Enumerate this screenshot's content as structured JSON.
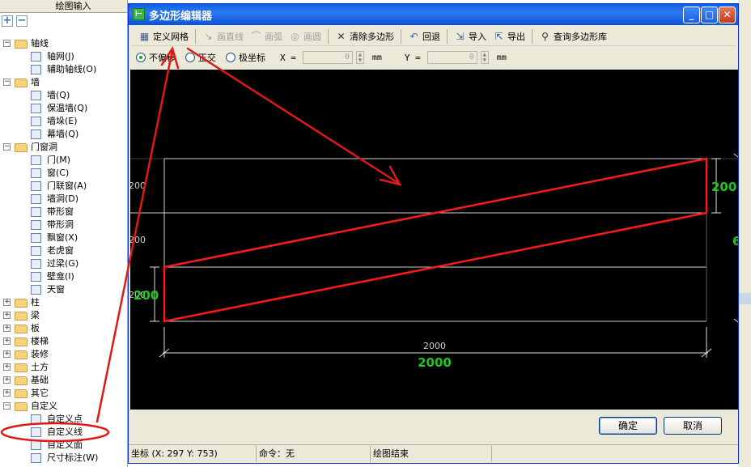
{
  "left_panel": {
    "header": "绘图输入",
    "tree": [
      {
        "type": "cat",
        "label": "轴线",
        "open": true
      },
      {
        "type": "leaf",
        "label": "轴网(J)"
      },
      {
        "type": "leaf",
        "label": "辅助轴线(O)"
      },
      {
        "type": "cat",
        "label": "墙",
        "open": true
      },
      {
        "type": "leaf",
        "label": "墙(Q)"
      },
      {
        "type": "leaf",
        "label": "保温墙(Q)"
      },
      {
        "type": "leaf",
        "label": "墙垛(E)"
      },
      {
        "type": "leaf",
        "label": "幕墙(Q)"
      },
      {
        "type": "cat",
        "label": "门窗洞",
        "open": true
      },
      {
        "type": "leaf",
        "label": "门(M)"
      },
      {
        "type": "leaf",
        "label": "窗(C)"
      },
      {
        "type": "leaf",
        "label": "门联窗(A)"
      },
      {
        "type": "leaf",
        "label": "墙洞(D)"
      },
      {
        "type": "leaf",
        "label": "带形窗"
      },
      {
        "type": "leaf",
        "label": "带形洞"
      },
      {
        "type": "leaf",
        "label": "飘窗(X)"
      },
      {
        "type": "leaf",
        "label": "老虎窗"
      },
      {
        "type": "leaf",
        "label": "过梁(G)"
      },
      {
        "type": "leaf",
        "label": "壁龛(I)"
      },
      {
        "type": "leaf",
        "label": "天窗"
      },
      {
        "type": "cat",
        "label": "柱",
        "open": false
      },
      {
        "type": "cat",
        "label": "梁",
        "open": false
      },
      {
        "type": "cat",
        "label": "板",
        "open": false
      },
      {
        "type": "cat",
        "label": "楼梯",
        "open": false
      },
      {
        "type": "cat",
        "label": "装修",
        "open": false
      },
      {
        "type": "cat",
        "label": "土方",
        "open": false
      },
      {
        "type": "cat",
        "label": "基础",
        "open": false
      },
      {
        "type": "cat",
        "label": "其它",
        "open": false
      },
      {
        "type": "cat",
        "label": "自定义",
        "open": true
      },
      {
        "type": "leaf",
        "label": "自定义点"
      },
      {
        "type": "leaf",
        "label": "自定义线"
      },
      {
        "type": "leaf",
        "label": "自定义面"
      },
      {
        "type": "leaf",
        "label": "尺寸标注(W)"
      }
    ]
  },
  "dialog": {
    "title": "多边形编辑器",
    "toolbar": {
      "define_grid": "定义网格",
      "draw_line": "画直线",
      "draw_arc": "画弧",
      "draw_circle": "画圆",
      "clear_polygon": "清除多边形",
      "undo": "回退",
      "import": "导入",
      "export": "导出",
      "query_library": "查询多边形库"
    },
    "options": {
      "no_offset": "不偏移",
      "orthogonal": "正交",
      "polar": "极坐标",
      "x_label": "X =",
      "x_value": "0",
      "y_label": "Y =",
      "y_value": "0",
      "unit": "mm"
    },
    "canvas": {
      "row_label_1": "200",
      "row_label_2": "200",
      "row_label_3": "200",
      "dim_right_top": "200",
      "dim_right_mid": "6",
      "dim_left": "200",
      "dim_bottom_white": "2000",
      "dim_bottom_green": "2000"
    },
    "buttons": {
      "ok": "确定",
      "cancel": "取消"
    },
    "status": {
      "coord": "坐标 (X: 297 Y: 753)",
      "command": "命令：无",
      "state": "绘图结束"
    }
  },
  "colors": {
    "canvas_bg": "#000000",
    "grid": "#d0d0d0",
    "polygon": "#ff1a1a",
    "dimension": "#21c421",
    "annotation": "#e01818",
    "title_bar": "#0a5fe0"
  }
}
